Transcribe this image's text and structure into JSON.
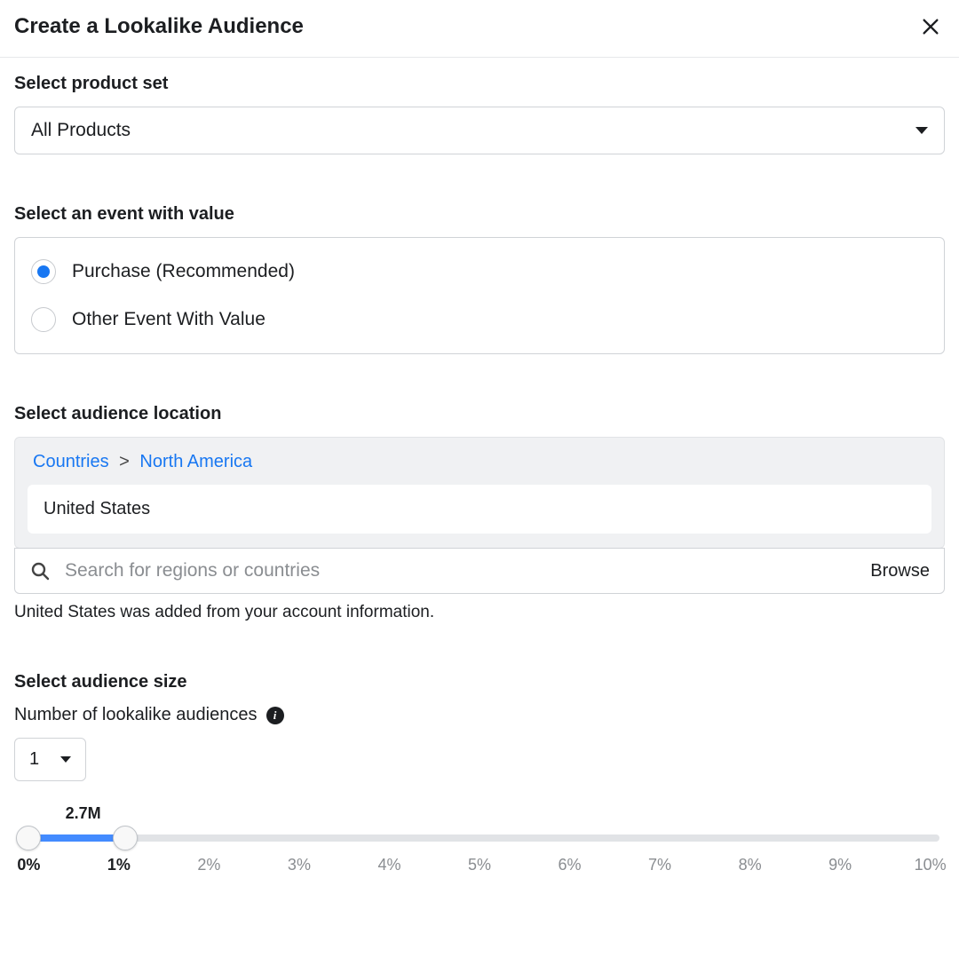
{
  "header": {
    "title": "Create a Lookalike Audience"
  },
  "product_set": {
    "label": "Select product set",
    "selected": "All Products"
  },
  "event": {
    "label": "Select an event with value",
    "options": {
      "purchase": "Purchase (Recommended)",
      "other": "Other Event With Value"
    }
  },
  "location": {
    "label": "Select audience location",
    "breadcrumb": {
      "root": "Countries",
      "sep": ">",
      "region": "North America"
    },
    "selected": "United States",
    "search_placeholder": "Search for regions or countries",
    "browse_label": "Browse",
    "note": "United States was added from your account information."
  },
  "size": {
    "label": "Select audience size",
    "sub_label": "Number of lookalike audiences",
    "count": "1",
    "value_label": "2.7M",
    "ticks": [
      "0%",
      "1%",
      "2%",
      "3%",
      "4%",
      "5%",
      "6%",
      "7%",
      "8%",
      "9%",
      "10%"
    ],
    "active_tick_indices": [
      0,
      1
    ]
  }
}
